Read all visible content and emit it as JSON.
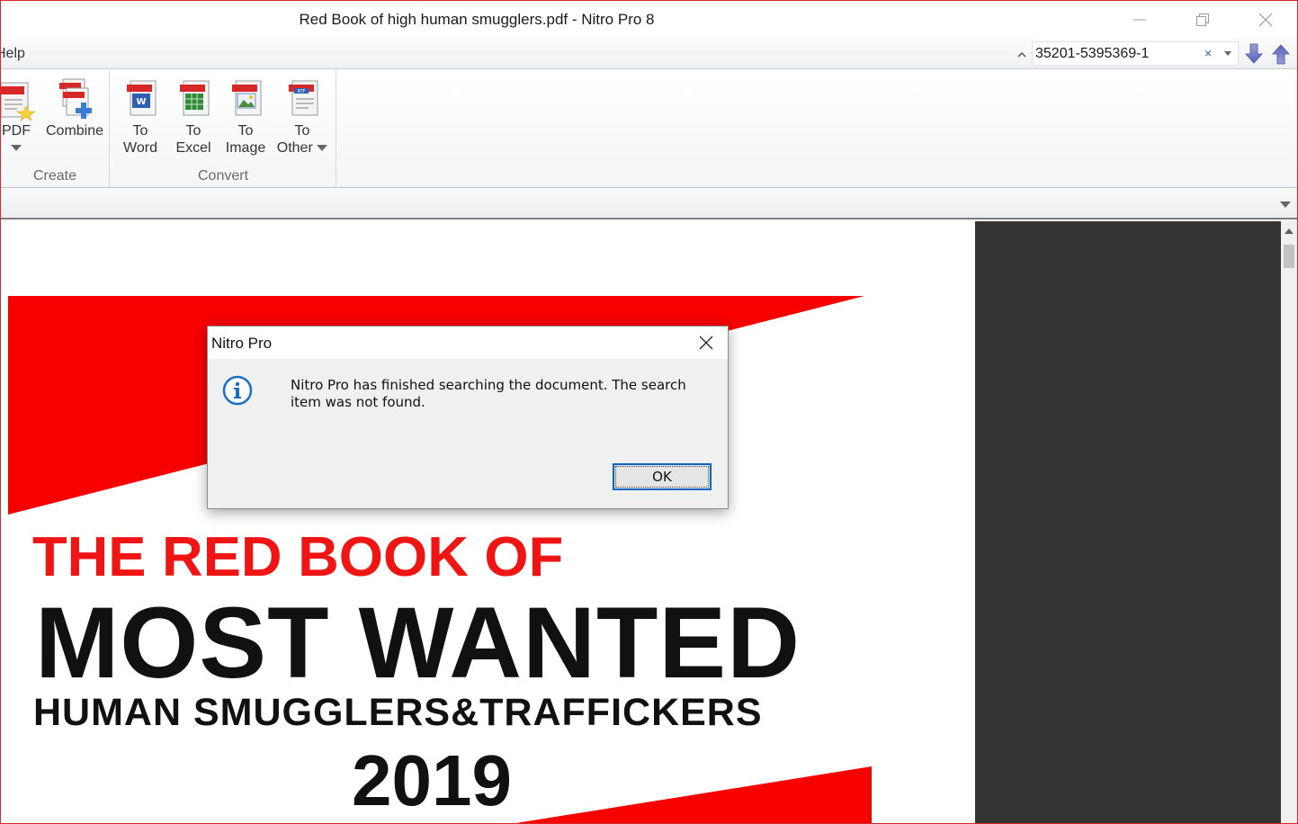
{
  "window": {
    "title": "Red Book of high human smugglers.pdf - Nitro Pro 8",
    "controls": [
      "minimize",
      "restore",
      "close"
    ]
  },
  "menubar": {
    "help_label": "Help",
    "find": {
      "value": "35201-5395369-1",
      "clear_symbol": "×"
    }
  },
  "ribbon": {
    "groups": [
      {
        "label": "Create",
        "buttons": [
          {
            "label_line1": "PDF",
            "label_line2": "",
            "icon": "create-pdf-icon",
            "has_dropdown": true
          },
          {
            "label_line1": "Combine",
            "label_line2": "",
            "icon": "combine-icon",
            "has_dropdown": false
          }
        ]
      },
      {
        "label": "Convert",
        "buttons": [
          {
            "label_line1": "To",
            "label_line2": "Word",
            "icon": "word-doc-icon"
          },
          {
            "label_line1": "To",
            "label_line2": "Excel",
            "icon": "excel-doc-icon"
          },
          {
            "label_line1": "To",
            "label_line2": "Image",
            "icon": "image-doc-icon"
          },
          {
            "label_line1": "To",
            "label_line2": "Other",
            "icon": "rtf-doc-icon",
            "has_dropdown": true
          }
        ]
      }
    ]
  },
  "document": {
    "cover": {
      "line1": "THE RED BOOK OF",
      "line2": "MOST WANTED",
      "line3": "HUMAN SMUGGLERS&TRAFFICKERS",
      "line4": "2019"
    }
  },
  "dialog": {
    "title": "Nitro Pro",
    "icon": "info-icon",
    "message": "Nitro Pro has finished searching the document. The search item was not found.",
    "ok_label": "OK"
  },
  "colors": {
    "window_border": "#d9262f",
    "cover_red": "#f01515",
    "dark_pane": "#343434",
    "ok_focus": "#0a64c8"
  }
}
